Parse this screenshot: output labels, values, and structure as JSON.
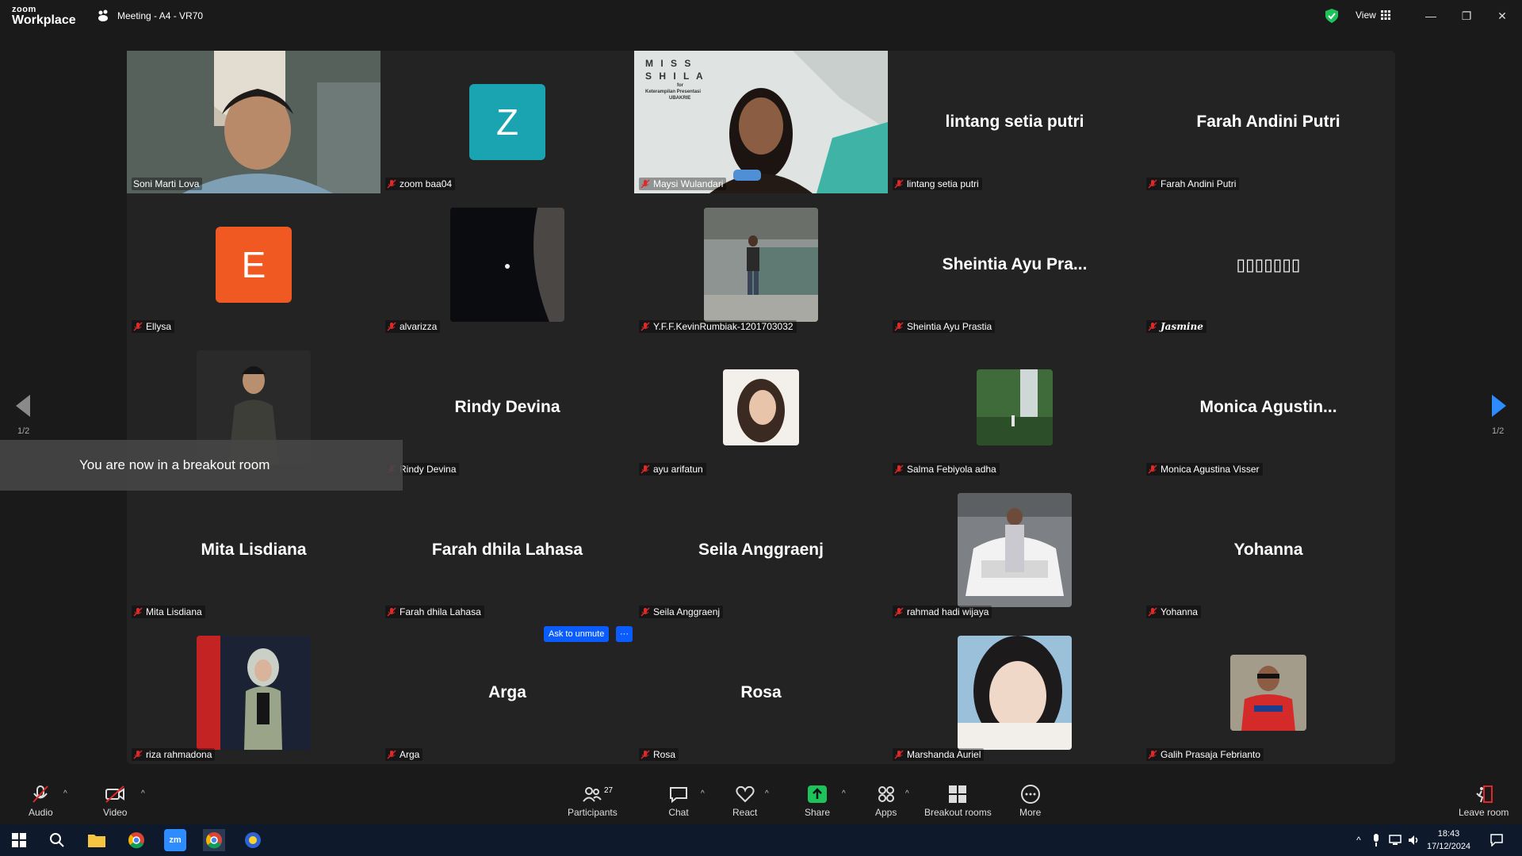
{
  "app": {
    "brand_top": "zoom",
    "brand_bottom": "Workplace",
    "meeting_title": "Meeting - A4 - VR70",
    "view_label": "View"
  },
  "tiles": [
    {
      "name": "Soni Marti Lova",
      "big": "",
      "type": "video"
    },
    {
      "name": "zoom baa04",
      "big": "",
      "type": "letter",
      "letter": "Z",
      "color": "#1aa3b0"
    },
    {
      "name": "Maysi Wulandari",
      "big": "",
      "type": "video",
      "overlay_lines": [
        "M I S S",
        "S H I L A",
        "for",
        "Keterampilan Presentasi",
        "UBAKRIE"
      ]
    },
    {
      "name": "lintang setia putri",
      "big": "lintang setia putri",
      "type": "name"
    },
    {
      "name": "Farah Andini Putri",
      "big": "Farah Andini Putri",
      "type": "name"
    },
    {
      "name": "Ellysa",
      "big": "",
      "type": "letter",
      "letter": "E",
      "color": "#f05a22"
    },
    {
      "name": "alvarizza",
      "big": "",
      "type": "photo"
    },
    {
      "name": "Y.F.F.KevinRumbiak-1201703032",
      "big": "",
      "type": "photo"
    },
    {
      "name": "Sheintia Ayu Prastia",
      "big": "Sheintia Ayu Pra...",
      "type": "name"
    },
    {
      "name": "Jasmine",
      "big": "▯▯▯▯▯▯▯",
      "type": "name"
    },
    {
      "name": "",
      "big": "",
      "type": "photo"
    },
    {
      "name": "Rindy Devina",
      "big": "Rindy Devina",
      "type": "name"
    },
    {
      "name": "ayu arifatun",
      "big": "",
      "type": "photo"
    },
    {
      "name": "Salma Febiyola adha",
      "big": "",
      "type": "photo"
    },
    {
      "name": "Monica Agustina Visser",
      "big": "Monica  Agustin...",
      "type": "name"
    },
    {
      "name": "Mita Lisdiana",
      "big": "Mita Lisdiana",
      "type": "name"
    },
    {
      "name": "Farah dhila Lahasa",
      "big": "Farah dhila Lahasa",
      "type": "name"
    },
    {
      "name": "Seila Anggraenj",
      "big": "Seila Anggraenj",
      "type": "name"
    },
    {
      "name": "rahmad hadi wijaya",
      "big": "",
      "type": "photo"
    },
    {
      "name": "Yohanna",
      "big": "Yohanna",
      "type": "name"
    },
    {
      "name": "riza rahmadona",
      "big": "",
      "type": "photo"
    },
    {
      "name": "Arga",
      "big": "Arga",
      "type": "name"
    },
    {
      "name": "Rosa",
      "big": "Rosa",
      "type": "name"
    },
    {
      "name": "Marshanda Auriel",
      "big": "",
      "type": "photo"
    },
    {
      "name": "Galih Prasaja Febrianto",
      "big": "",
      "type": "photo"
    }
  ],
  "pagination": {
    "left": "1/2",
    "right": "1/2"
  },
  "toast": "You are now in a breakout room",
  "unmute": {
    "label": "Ask to unmute",
    "more": "···"
  },
  "toolbar": {
    "audio": "Audio",
    "video": "Video",
    "participants": "Participants",
    "participants_count": "27",
    "chat": "Chat",
    "react": "React",
    "share": "Share",
    "apps": "Apps",
    "breakout": "Breakout rooms",
    "more": "More",
    "leave": "Leave room"
  },
  "clock": {
    "time": "18:43",
    "date": "17/12/2024"
  },
  "colors": {
    "accent": "#0b5cff",
    "active_speaker": "#2ecc8e",
    "share": "#1ec25a",
    "muted": "#e02828"
  }
}
